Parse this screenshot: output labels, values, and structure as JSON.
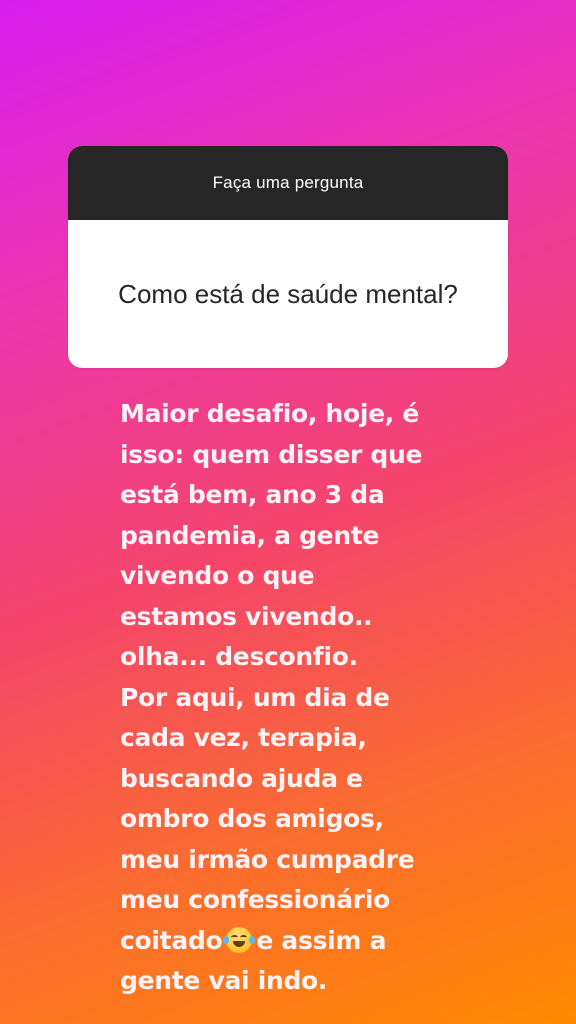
{
  "question_sticker": {
    "header": "Faça uma pergunta",
    "question": "Como está de saúde mental?"
  },
  "answer": {
    "lines": [
      "Maior desafio, hoje, é",
      "isso: quem disser que",
      "está bem, ano 3 da",
      "pandemia, a gente",
      "vivendo o que",
      "estamos vivendo..",
      "olha... desconfio.",
      "Por aqui, um dia de",
      "cada vez, terapia,",
      "buscando ajuda e",
      "ombro dos amigos,",
      "meu irmão cumpadre",
      "meu confessionário"
    ],
    "line14_before_emoji": "coitado",
    "line14_after_emoji": "e assim a",
    "line15": "gente vai indo.",
    "emoji_icon": "face-with-tears-of-joy-icon"
  },
  "colors": {
    "background_gradient": [
      "#d81ef0",
      "#ec38a8",
      "#f5456a",
      "#fa6a32",
      "#ff8a00"
    ],
    "sticker_header_bg": "#262626",
    "sticker_body_bg": "#ffffff",
    "answer_text": "#fdf3f6"
  }
}
